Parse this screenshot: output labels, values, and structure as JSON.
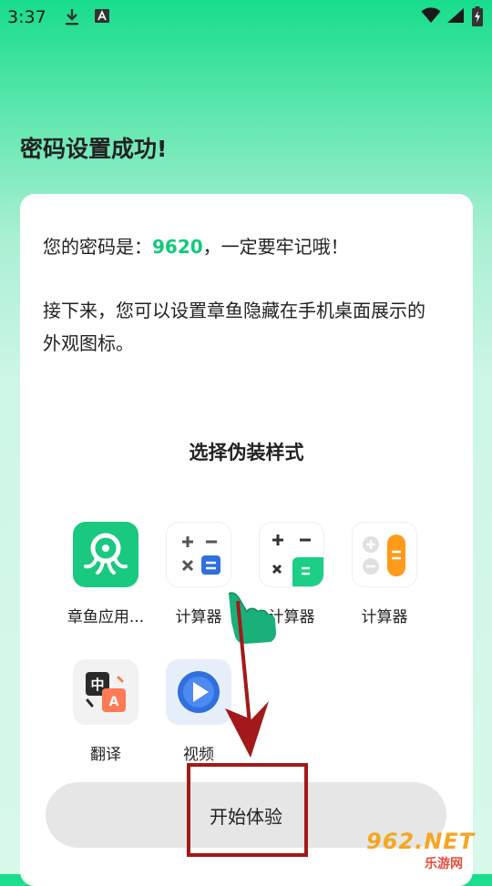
{
  "status_bar": {
    "time": "3:37"
  },
  "header": {
    "title": "密码设置成功!"
  },
  "card": {
    "password_prefix": "您的密码是：",
    "password_value": "9620",
    "password_suffix": "，一定要牢记哦！",
    "description": "接下来，您可以设置章鱼隐藏在手机桌面展示的外观图标。",
    "section_title": "选择伪装样式",
    "options": [
      {
        "label": "章鱼应用...",
        "icon": "octopus-app-icon"
      },
      {
        "label": "计算器",
        "icon": "calculator-white-icon"
      },
      {
        "label": "计算器",
        "icon": "calculator-green-icon"
      },
      {
        "label": "计算器",
        "icon": "calculator-orange-icon"
      },
      {
        "label": "翻译",
        "icon": "translate-icon"
      },
      {
        "label": "视频",
        "icon": "video-play-icon"
      }
    ]
  },
  "footer": {
    "start_button_label": "开始体验"
  },
  "watermark": {
    "top": "962.NET",
    "bottom": "乐游网"
  },
  "colors": {
    "accent": "#12c97b",
    "annotation_red": "#a31919",
    "button_bg": "#e6e6e6"
  }
}
